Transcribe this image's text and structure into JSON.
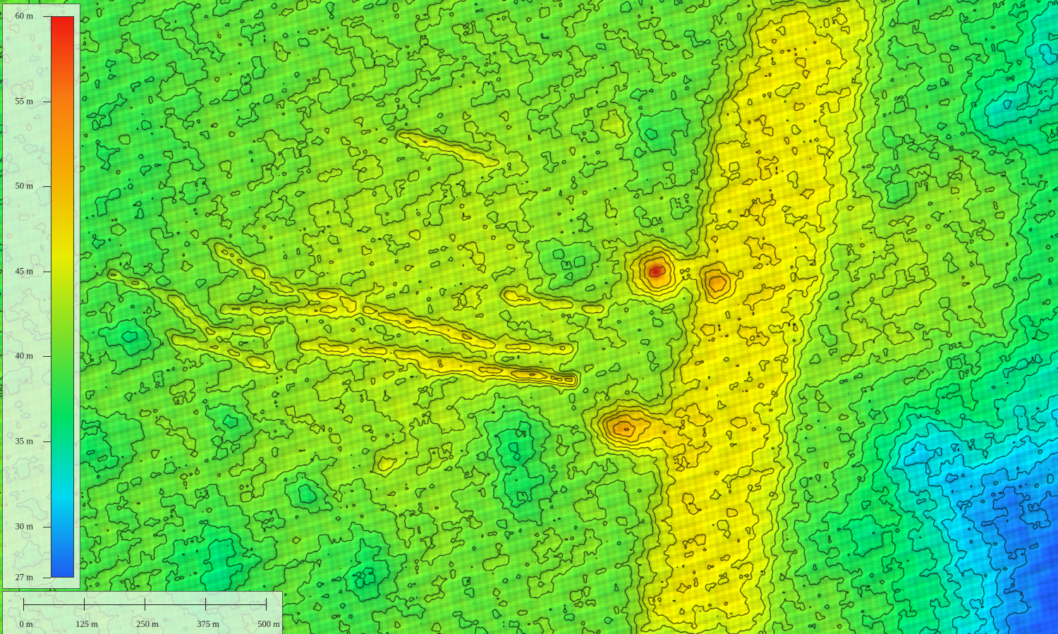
{
  "legend": {
    "unit": "m",
    "min": 27,
    "max": 60,
    "labels": [
      {
        "value": 60,
        "text": "60 m"
      },
      {
        "value": 55,
        "text": "55 m"
      },
      {
        "value": 50,
        "text": "50 m"
      },
      {
        "value": 45,
        "text": "45 m"
      },
      {
        "value": 40,
        "text": "40 m"
      },
      {
        "value": 35,
        "text": "35 m"
      },
      {
        "value": 30,
        "text": "30 m"
      },
      {
        "value": 27,
        "text": "27 m"
      }
    ],
    "colors": [
      "#1e5cf0",
      "#00d8f0",
      "#00e060",
      "#7ce02a",
      "#e8ec00",
      "#f6b000",
      "#f87a10",
      "#f01a10"
    ]
  },
  "scale_bar": {
    "labels": [
      "0 m",
      "125 m",
      "250 m",
      "375 m",
      "500 m"
    ],
    "values_m": [
      0,
      125,
      250,
      375,
      500
    ]
  },
  "map": {
    "type": "elevation-contour-map",
    "contour_color": "#111111",
    "low_color": "#22d8e8",
    "high_color": "#d0701a",
    "peak_color": "#c41a14"
  }
}
